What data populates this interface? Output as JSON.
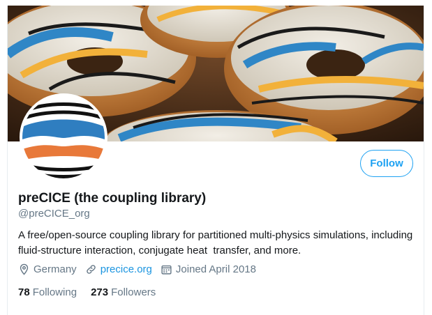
{
  "profile": {
    "display_name": "preCICE (the coupling library)",
    "handle": "@preCICE_org",
    "bio": "A free/open-source coupling library for partitioned multi-physics simulations, including  fluid-structure interaction, conjugate heat  transfer, and more.",
    "location": "Germany",
    "website": "precice.org",
    "joined": "Joined April 2018",
    "following_count": "78",
    "following_label": "Following",
    "followers_count": "273",
    "followers_label": "Followers"
  },
  "actions": {
    "follow_label": "Follow"
  },
  "icons": {
    "location": "location-pin-icon",
    "link": "link-icon",
    "calendar": "calendar-icon"
  },
  "colors": {
    "accent": "#1da1f2",
    "link": "#1b95e0",
    "muted": "#657786",
    "text": "#14171a",
    "logo_blue": "#2f7ec0",
    "logo_orange": "#e8793a"
  }
}
